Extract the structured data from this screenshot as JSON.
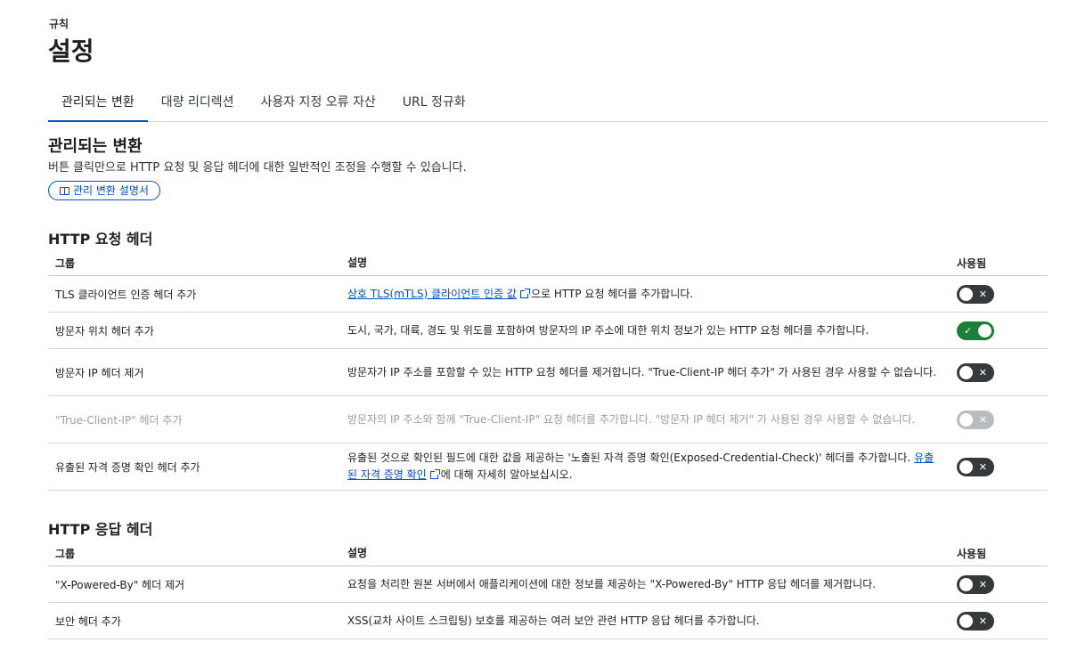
{
  "page": {
    "breadcrumb": "규칙",
    "title": "설정"
  },
  "tabs": [
    {
      "label": "관리되는 변환",
      "active": true
    },
    {
      "label": "대량 리디렉션",
      "active": false
    },
    {
      "label": "사용자 지정 오류 자산",
      "active": false
    },
    {
      "label": "URL 정규화",
      "active": false
    }
  ],
  "section": {
    "title": "관리되는 변환",
    "description": "버튼 클릭만으로 HTTP 요청 및 응답 헤더에 대한 일반적인 조정을 수행할 수 있습니다.",
    "doc_button": "관리 변환 설명서",
    "doc_icon": "book-icon"
  },
  "request_headers": {
    "title": "HTTP 요청 헤더",
    "columns": {
      "group": "그룹",
      "description": "설명",
      "enabled": "사용됨"
    },
    "rows": [
      {
        "group": "TLS 클라이언트 인증 헤더 추가",
        "link": "상호 TLS(mTLS) 클라이언트 인증 값",
        "desc": "으로 HTTP 요청 헤더를 추가합니다.",
        "enabled": false,
        "disabled": false
      },
      {
        "group": "방문자 위치 헤더 추가",
        "desc": "도시, 국가, 대륙, 경도 및 위도를 포함하여 방문자의 IP 주소에 대한 위치 정보가 있는 HTTP 요청 헤더를 추가합니다.",
        "enabled": true,
        "disabled": false
      },
      {
        "group": "방문자 IP 헤더 제거",
        "desc": "방문자가 IP 주소를 포함할 수 있는 HTTP 요청 헤더를 제거합니다. \"True-Client-IP 헤더 추가\" 가 사용된 경우 사용할 수 없습니다.",
        "enabled": false,
        "disabled": false
      },
      {
        "group": "\"True-Client-IP\" 헤더 추가",
        "desc": "방문자의 IP 주소와 함께 \"True-Client-IP\" 요청 헤더를 추가합니다. \"방문자 IP 헤더 제거\" 가 사용된 경우 사용할 수 없습니다.",
        "enabled": false,
        "disabled": true
      },
      {
        "group": "유출된 자격 증명 확인 헤더 추가",
        "desc": "유출된 것으로 확인된 필드에 대한 값을 제공하는 '노출된 자격 증명 확인(Exposed-Credential-Check)' 헤더를 추가합니다. ",
        "link": "유출된 자격 증명 확인",
        "desc_after": "에 대해 자세히 알아보십시오.",
        "enabled": false,
        "disabled": false
      }
    ]
  },
  "response_headers": {
    "title": "HTTP 응답 헤더",
    "columns": {
      "group": "그룹",
      "description": "설명",
      "enabled": "사용됨"
    },
    "rows": [
      {
        "group": "\"X-Powered-By\" 헤더 제거",
        "desc": "요청을 처리한 원본 서버에서 애플리케이션에 대한 정보를 제공하는 \"X-Powered-By\" HTTP 응답 헤더를 제거합니다.",
        "enabled": false,
        "disabled": false
      },
      {
        "group": "보안 헤더 추가",
        "desc": "XSS(교차 사이트 스크립팅) 보호를 제공하는 여러 보안 관련 HTTP 응답 헤더를 추가합니다.",
        "enabled": false,
        "disabled": false
      }
    ]
  },
  "toggle": {
    "on_symbol": "✓",
    "off_symbol": "✕"
  },
  "colors": {
    "accent": "#0051c3",
    "toggle_on": "#1a7f37",
    "toggle_off": "#36393a",
    "toggle_disabled": "#b9bbbc"
  }
}
